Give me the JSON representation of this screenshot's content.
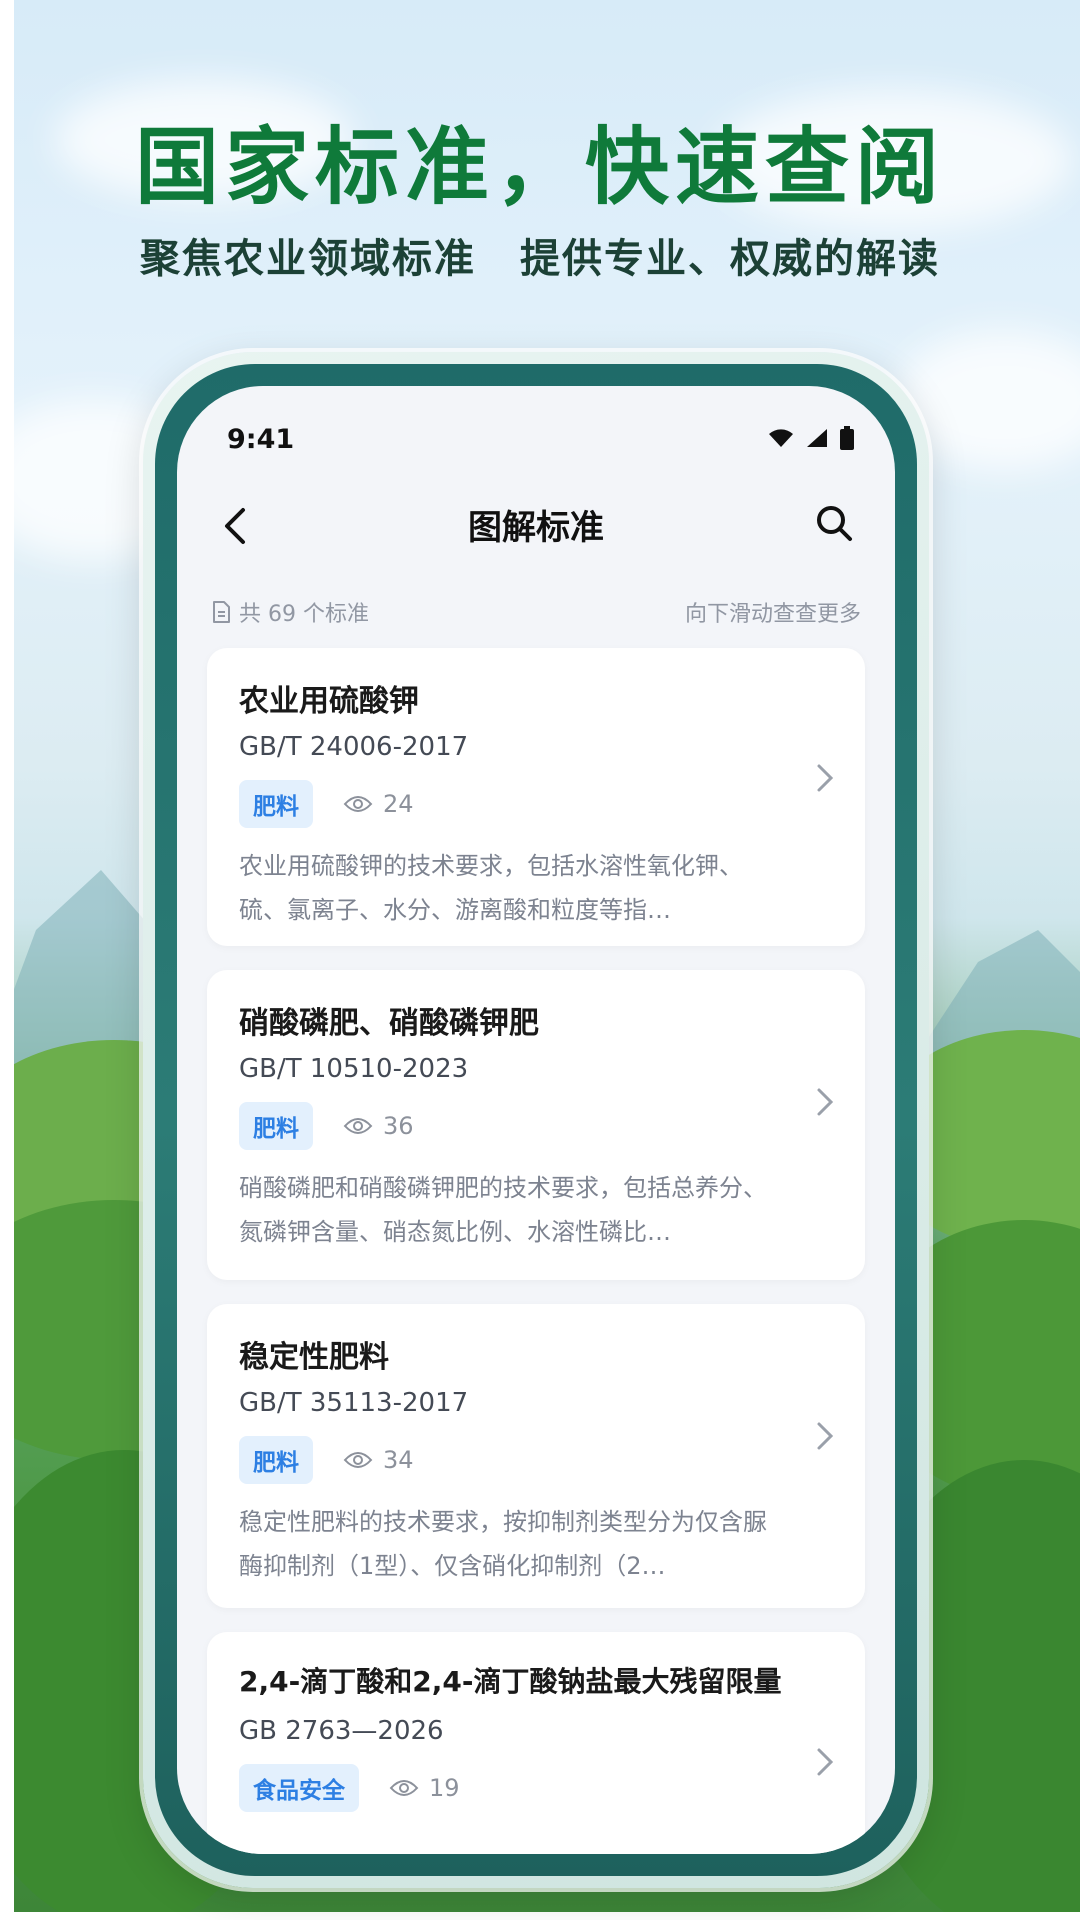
{
  "hero": {
    "title": "国家标准，快速查阅",
    "subtitle_left": "聚焦农业领域标准",
    "subtitle_right": "提供专业、权威的解读"
  },
  "status_bar": {
    "time": "9:41"
  },
  "nav": {
    "title": "图解标准"
  },
  "meta": {
    "count_text": "共 69 个标准",
    "hint_text": "向下滑动查查更多"
  },
  "standards": [
    {
      "title": "农业用硫酸钾",
      "code": "GB/T 24006-2017",
      "tag": "肥料",
      "views": "24",
      "desc": "农业用硫酸钾的技术要求，包括水溶性氧化钾、硫、氯离子、水分、游离酸和粒度等指…"
    },
    {
      "title": "硝酸磷肥、硝酸磷钾肥",
      "code": "GB/T 10510-2023",
      "tag": "肥料",
      "views": "36",
      "desc": "硝酸磷肥和硝酸磷钾肥的技术要求，包括总养分、氮磷钾含量、硝态氮比例、水溶性磷比…"
    },
    {
      "title": "稳定性肥料",
      "code": "GB/T 35113-2017",
      "tag": "肥料",
      "views": "34",
      "desc": "稳定性肥料的技术要求，按抑制剂类型分为仅含脲酶抑制剂（1型）、仅含硝化抑制剂（2…"
    },
    {
      "title": "2,4-滴丁酸和2,4-滴丁酸钠盐最大残留限量",
      "code": "GB 2763—2026",
      "tag": "食品安全",
      "views": "19",
      "desc": ""
    }
  ],
  "colors": {
    "title_green": "#0f7a3a",
    "tag_bg": "#e3f0fd",
    "tag_text": "#2d7fe3",
    "phone_bezel": "#1f6b69"
  },
  "icons": [
    "chevron-left-icon",
    "search-icon",
    "wifi-icon",
    "signal-icon",
    "battery-icon",
    "document-icon",
    "eye-icon",
    "chevron-right-icon"
  ]
}
